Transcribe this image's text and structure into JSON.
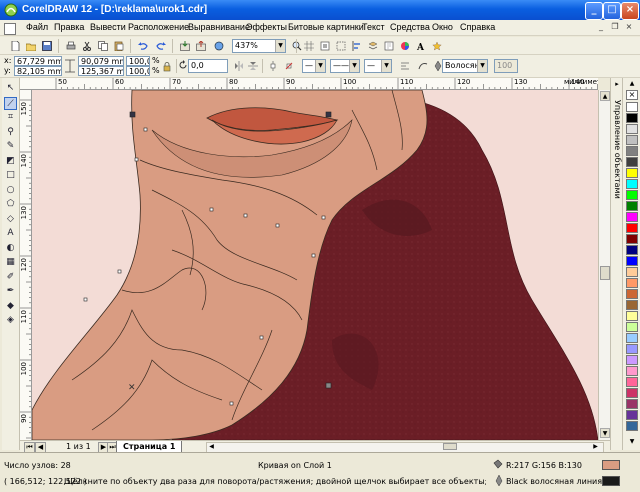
{
  "window": {
    "title": "CorelDRAW 12 - [D:\\reklama\\urok1.cdr]"
  },
  "menu": [
    "Файл",
    "Правка",
    "Вывести",
    "Расположение",
    "Выравнивание",
    "Эффекты",
    "Битовые картинки",
    "Текст",
    "Средства",
    "Окно",
    "Справка"
  ],
  "toolbar": {
    "zoom": "437%"
  },
  "propbar": {
    "x": "67,729 mm",
    "y": "82,105 mm",
    "w": "90,079 mm",
    "h": "125,367 mm",
    "sx": "100,0",
    "sy": "100,0",
    "pct": "%",
    "angle": "0,0",
    "nib_value": "0",
    "outline_width": "Волосяная",
    "smoothness": "100"
  },
  "ruler": {
    "units": "миллиметры",
    "top": [
      "50",
      "60",
      "70",
      "80",
      "90",
      "100",
      "110",
      "120",
      "130",
      "140",
      "150"
    ],
    "left": [
      "150",
      "140",
      "130",
      "120",
      "110",
      "100",
      "90"
    ]
  },
  "docker": {
    "label": "Управление объектами"
  },
  "palette": {
    "colors": [
      "#ffffff",
      "#000000",
      "#e0e0e0",
      "#c0c0c0",
      "#808080",
      "#404040",
      "#ffff00",
      "#00ffff",
      "#00ff00",
      "#008000",
      "#ff00ff",
      "#ff0000",
      "#800000",
      "#000080",
      "#0000ff",
      "#ffcc99",
      "#ff9966",
      "#cc6633",
      "#996633",
      "#ffff99",
      "#ccff99",
      "#99ccff",
      "#9999ff",
      "#cc99ff",
      "#ff99cc",
      "#ff6699",
      "#cc3366",
      "#993366",
      "#663399",
      "#336699"
    ]
  },
  "pagenav": {
    "page_info": "1 из 1",
    "page_tab": "Страница 1"
  },
  "status": {
    "nodes": "Число узлов: 28",
    "curve": "Кривая on Слой 1",
    "fill_rgb": "R:217 G:156 B:130",
    "coords": "( 166,512; 122,522 )",
    "hint": "Щёлкните по объекту два раза для поворота/растяжения; двойной щелчок выбирает все объекты; Shift+щелчок - выбор не...",
    "outline": "Black  волосяная линия",
    "fill_color": "#d99c82",
    "outline_color": "#1a1a1a"
  },
  "illustration": {
    "skin_color": "#d99c82",
    "scarf_color": "#6b1e26",
    "lip_color": "#c1573f",
    "background": "#f3dcd6"
  }
}
